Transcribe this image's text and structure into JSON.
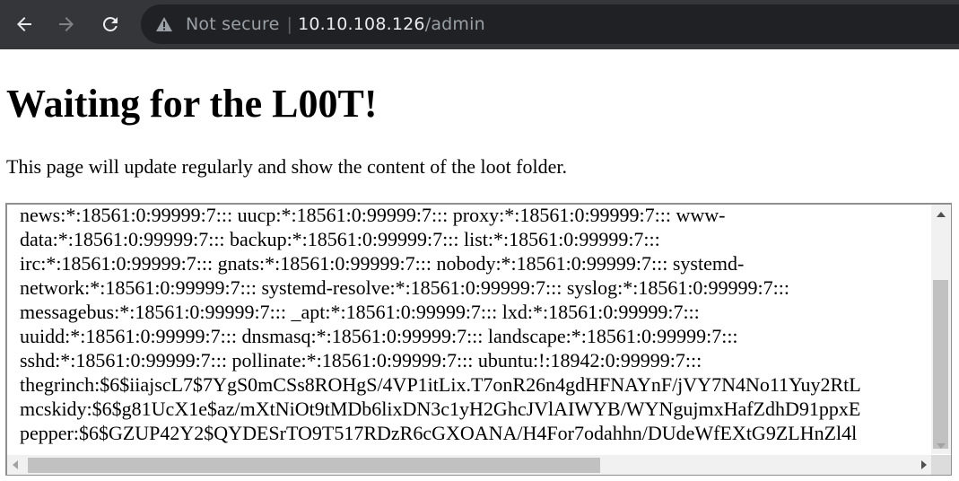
{
  "browser": {
    "security_label": "Not secure",
    "separator": "|",
    "url_host": "10.10.108.126",
    "url_path": "/admin"
  },
  "page": {
    "title": "Waiting for the L00T!",
    "intro": "This page will update regularly and show the content of the loot folder."
  },
  "loot": {
    "lines": [
      "news:*:18561:0:99999:7::: uucp:*:18561:0:99999:7::: proxy:*:18561:0:99999:7::: www-",
      "data:*:18561:0:99999:7::: backup:*:18561:0:99999:7::: list:*:18561:0:99999:7:::",
      "irc:*:18561:0:99999:7::: gnats:*:18561:0:99999:7::: nobody:*:18561:0:99999:7::: systemd-",
      "network:*:18561:0:99999:7::: systemd-resolve:*:18561:0:99999:7::: syslog:*:18561:0:99999:7:::",
      "messagebus:*:18561:0:99999:7::: _apt:*:18561:0:99999:7::: lxd:*:18561:0:99999:7:::",
      "uuidd:*:18561:0:99999:7::: dnsmasq:*:18561:0:99999:7::: landscape:*:18561:0:99999:7:::",
      "sshd:*:18561:0:99999:7::: pollinate:*:18561:0:99999:7::: ubuntu:!:18942:0:99999:7:::",
      "thegrinch:$6$iiajscL7$7YgS0mCSs8ROHgS/4VP1itLix.T7onR26n4gdHFNAYnF/jVY7N4No11Yuy2RtL",
      "mcskidy:$6$g81UcX1e$az/mXtNiOt9tMDb6lixDN3c1yH2GhcJVlAIWYB/WYNgujmxHafZdhD91ppxE",
      "pepper:$6$GZUP42Y2$QYDESrTO9T517RDzR6cGXOANA/H4For7odahhn/DUdeWfEXtG9ZLHnZl4l"
    ],
    "vertical_scroll_fraction": 0.32,
    "horizontal_scroll_fraction": 0.0
  },
  "icons": {
    "back": "arrow-left-icon",
    "forward": "arrow-right-icon",
    "reload": "reload-icon",
    "security": "warning-triangle-icon"
  }
}
